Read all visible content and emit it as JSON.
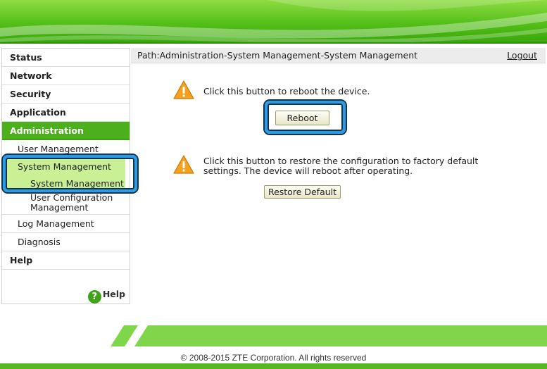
{
  "nav": {
    "items": [
      {
        "label": "Status"
      },
      {
        "label": "Network"
      },
      {
        "label": "Security"
      },
      {
        "label": "Application"
      },
      {
        "label": "Administration"
      }
    ],
    "admin_sub": {
      "user_management": "User Management",
      "system_management": "System Management",
      "system_management_child": "System Management",
      "user_configuration_management": "User Configuration Management",
      "log_management": "Log Management",
      "diagnosis": "Diagnosis"
    },
    "help_item": "Help",
    "help_link": "Help",
    "help_icon_glyph": "?"
  },
  "path": {
    "text": "Path:Administration-System Management-System Management",
    "logout": "Logout"
  },
  "reboot": {
    "message": "Click this button to reboot the device.",
    "button_label": "Reboot"
  },
  "restore": {
    "message_line1": "Click this button to restore the configuration to factory default",
    "message_line2": "settings. The device will reboot after operating.",
    "button_label": "Restore Default"
  },
  "footer": {
    "copyright": "© 2008-2015 ZTE Corporation. All rights reserved"
  },
  "colors": {
    "brand_green": "#4caf1c",
    "highlight_blue": "#2b9be6",
    "warning_orange": "#f0a020"
  }
}
